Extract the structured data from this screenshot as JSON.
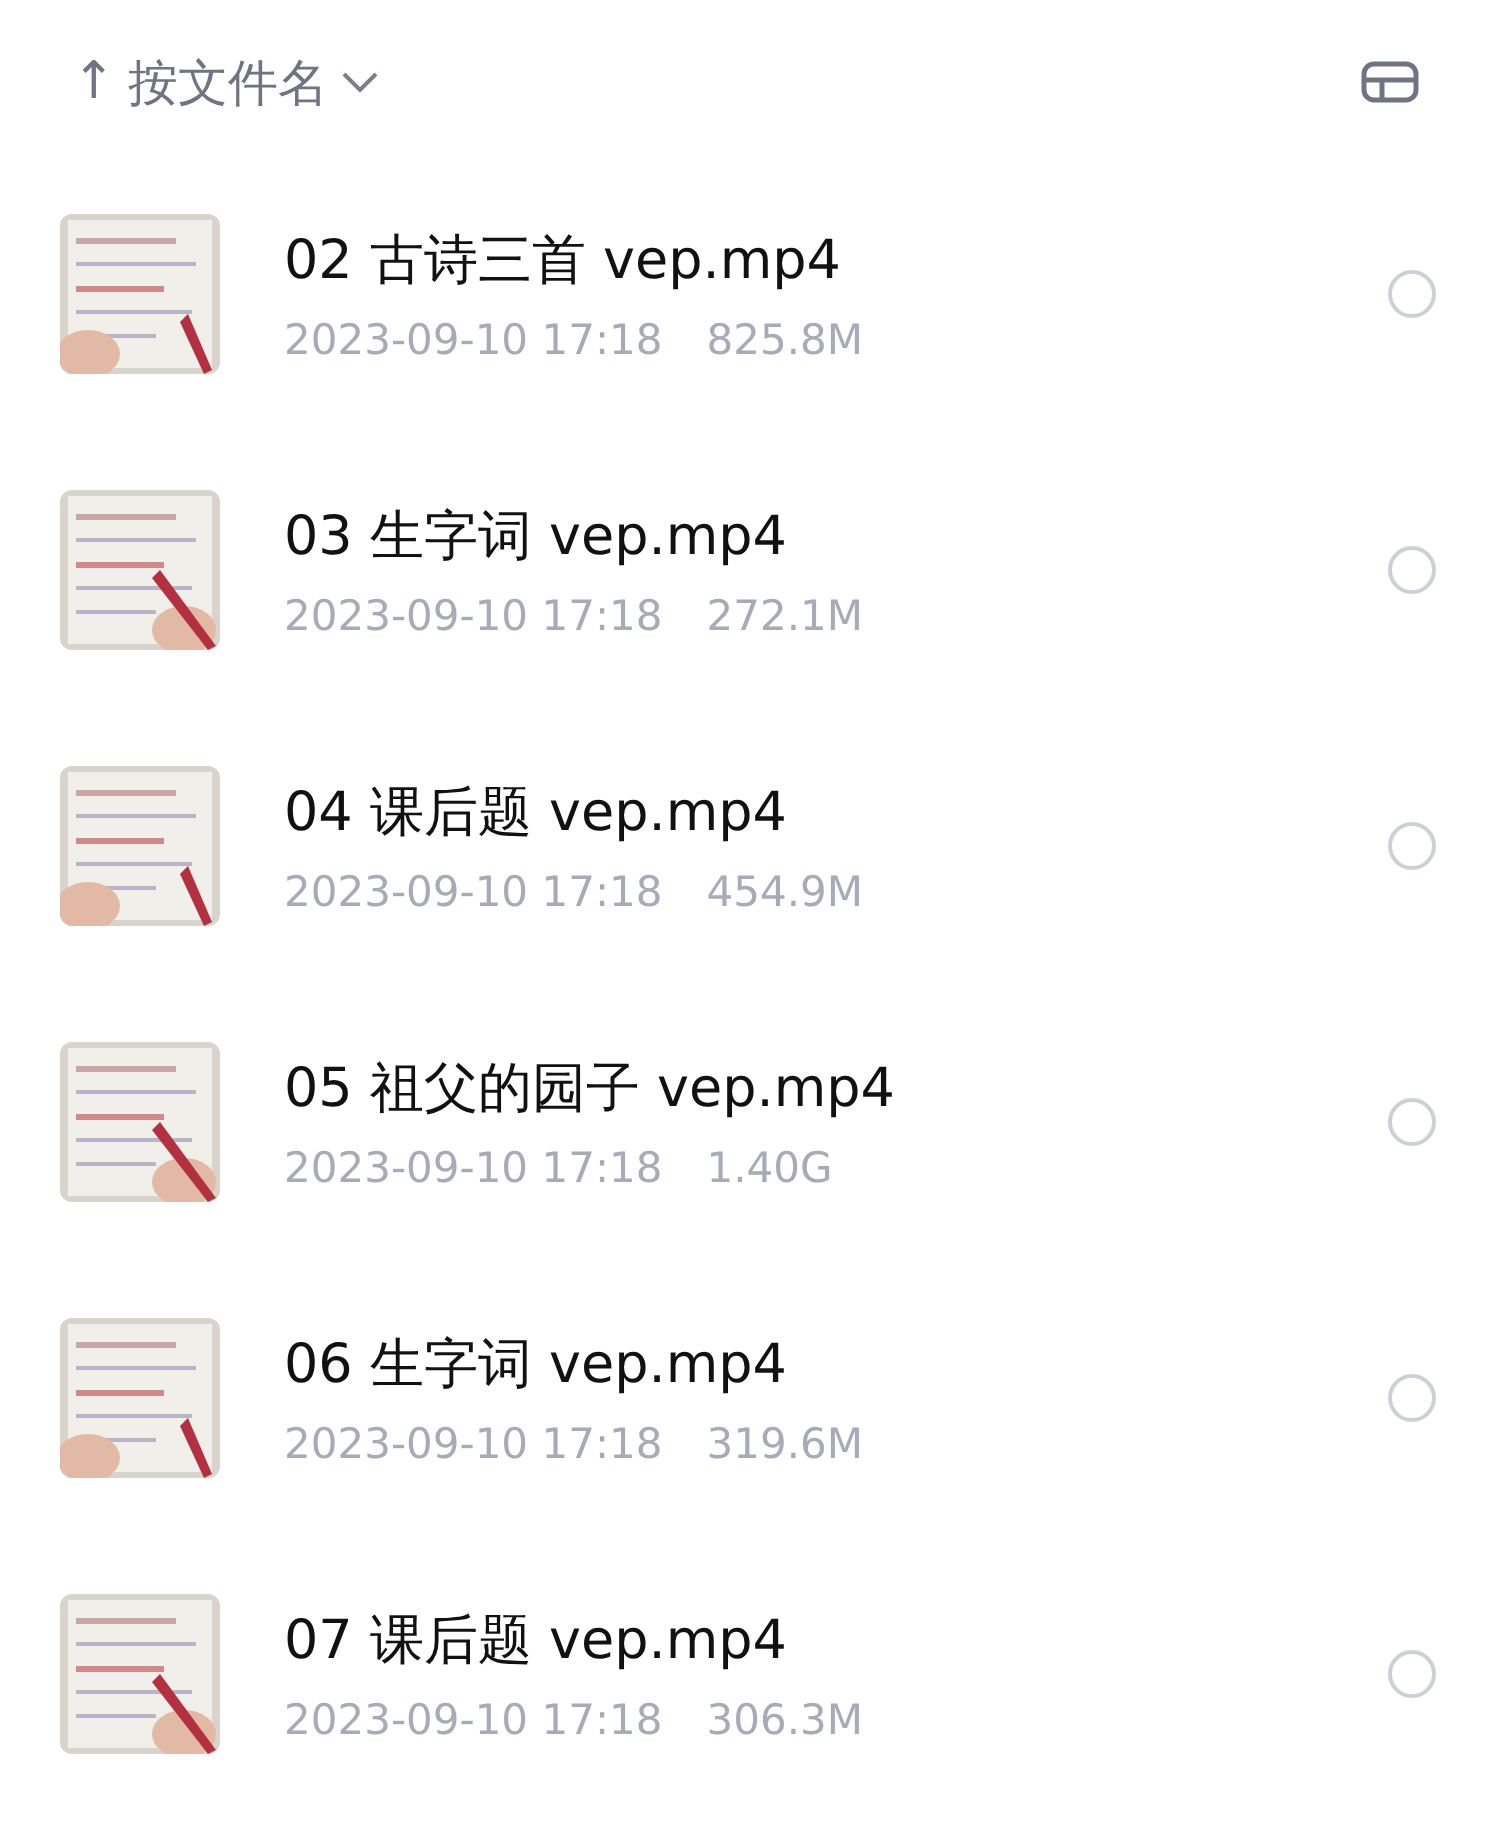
{
  "sort": {
    "arrow": "↑",
    "label": "按文件名"
  },
  "files": [
    {
      "name": "02 古诗三首 vep.mp4",
      "date": "2023-09-10 17:18",
      "size": "825.8M",
      "selected": false
    },
    {
      "name": "03 生字词 vep.mp4",
      "date": "2023-09-10 17:18",
      "size": "272.1M",
      "selected": false
    },
    {
      "name": "04 课后题 vep.mp4",
      "date": "2023-09-10 17:18",
      "size": "454.9M",
      "selected": false
    },
    {
      "name": "05 祖父的园子 vep.mp4",
      "date": "2023-09-10 17:18",
      "size": "1.40G",
      "selected": false
    },
    {
      "name": "06 生字词 vep.mp4",
      "date": "2023-09-10 17:18",
      "size": "319.6M",
      "selected": false
    },
    {
      "name": "07 课后题 vep.mp4",
      "date": "2023-09-10 17:18",
      "size": "306.3M",
      "selected": false
    }
  ]
}
